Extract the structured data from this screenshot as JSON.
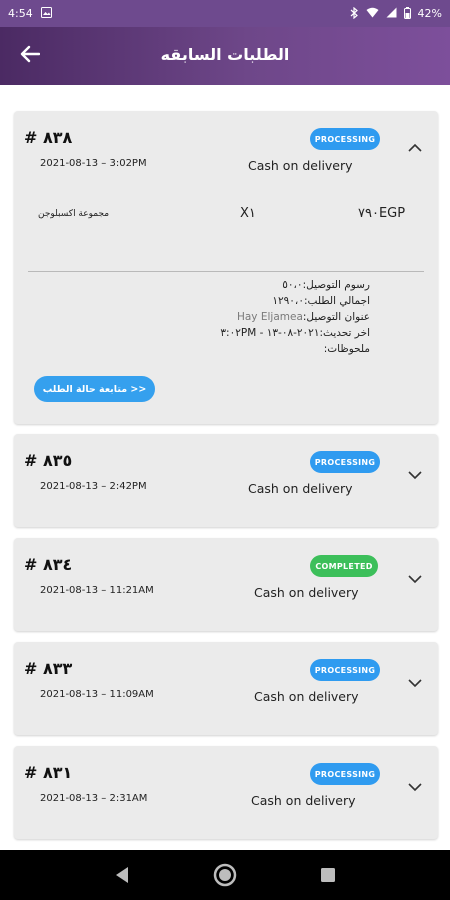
{
  "status_bar": {
    "time": "4:54",
    "battery": "42%",
    "icons": [
      "gallery-icon",
      "bluetooth-icon",
      "wifi-icon",
      "signal-icon",
      "battery-icon"
    ]
  },
  "header": {
    "title": "الطلبات السابقه",
    "back_icon": "arrow-left-icon"
  },
  "orders": [
    {
      "number": "# ٨٣٨",
      "status": "PROCESSING",
      "date": "2021-08-13 – 3:02PM",
      "payment": "Cash on delivery",
      "expanded": true,
      "item": {
        "name": "مجموعة اكسبلوجن",
        "qty": "X١",
        "price": "٧٩٠EGP"
      },
      "details": {
        "delivery_fee": "رسوم التوصيل:٥٠،٠",
        "total": "اجمالي الطلب:١٢٩٠،٠",
        "address_label": "عنوان التوصيل:",
        "address_value": "Hay Eljamea",
        "last_update": "اخر تحديث:٢٠٢١-٠٨-١٣ - ٣:٠٢PM",
        "notes": "ملحوظات:"
      },
      "track_button": "متابعة حالة الطلب >>"
    },
    {
      "number": "# ٨٣٥",
      "status": "PROCESSING",
      "date": "2021-08-13 – 2:42PM",
      "payment": "Cash on delivery",
      "expanded": false
    },
    {
      "number": "# ٨٣٤",
      "status": "COMPLETED",
      "date": "2021-08-13 – 11:21AM",
      "payment": "Cash on delivery",
      "expanded": false
    },
    {
      "number": "# ٨٣٣",
      "status": "PROCESSING",
      "date": "2021-08-13 – 11:09AM",
      "payment": "Cash on delivery",
      "expanded": false
    },
    {
      "number": "# ٨٣١",
      "status": "PROCESSING",
      "date": "2021-08-13 – 2:31AM",
      "payment": "Cash on delivery",
      "expanded": false
    }
  ],
  "colors": {
    "header_start": "#4b2a63",
    "header_end": "#7d4f9b",
    "processing": "#2f9bf0",
    "completed": "#3cbf5a",
    "card_bg": "#ebebeb"
  },
  "nav": {
    "back": "nav-back-icon",
    "home": "nav-home-icon",
    "recents": "nav-recents-icon"
  }
}
